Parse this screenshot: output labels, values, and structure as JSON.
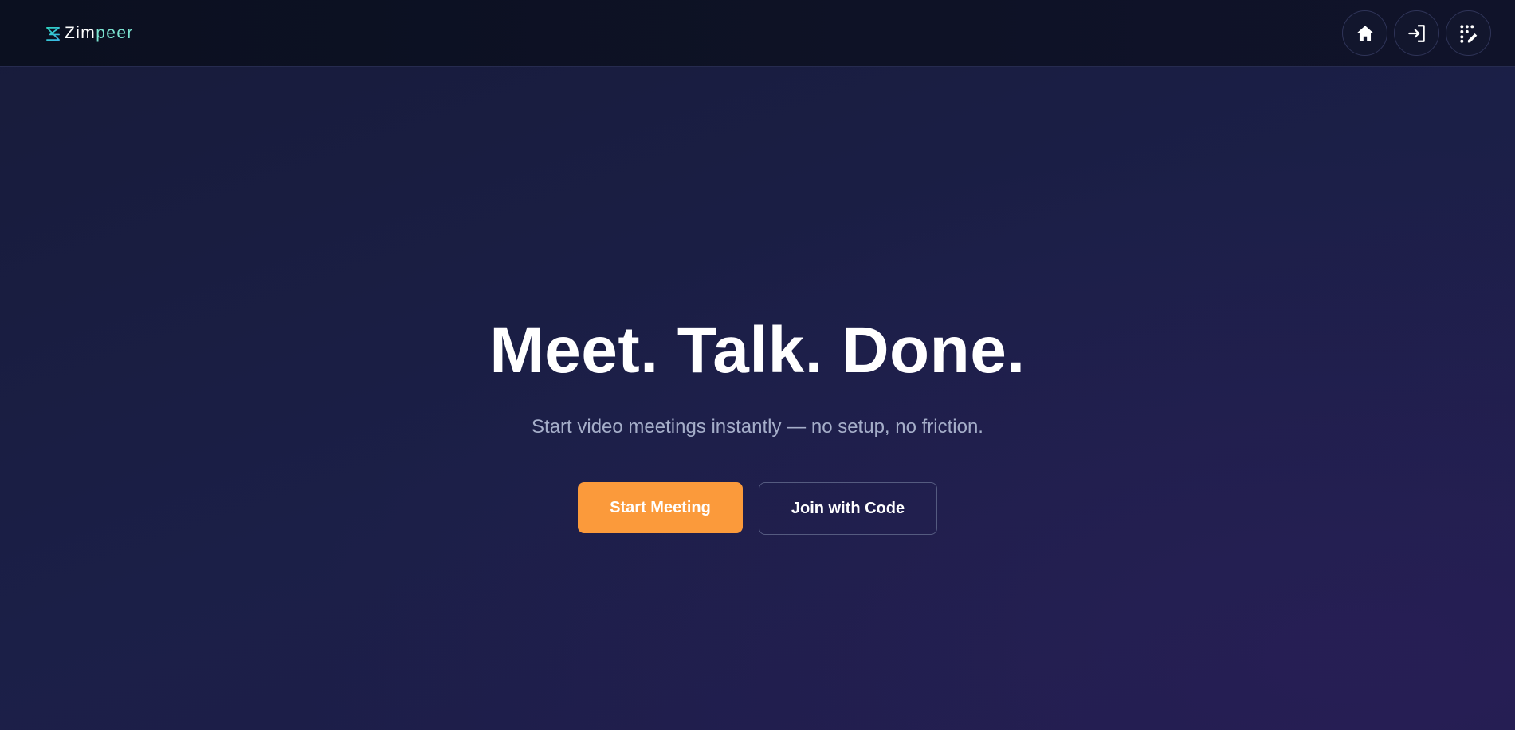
{
  "brand": {
    "name_part1": "Zim",
    "name_part2": "peer",
    "logo_icon": "z-logo-icon",
    "accent_color": "#2fd3c0"
  },
  "nav": {
    "icons": [
      "home-icon",
      "login-icon",
      "keypad-edit-icon"
    ]
  },
  "hero": {
    "title": "Meet. Talk. Done.",
    "subtitle": "Start video meetings instantly — no setup, no friction.",
    "primary_label": "Start Meeting",
    "secondary_label": "Join with Code"
  },
  "colors": {
    "primary_button": "#fb9a3b",
    "background": "#1b1e44",
    "topbar": "#0b1020"
  }
}
